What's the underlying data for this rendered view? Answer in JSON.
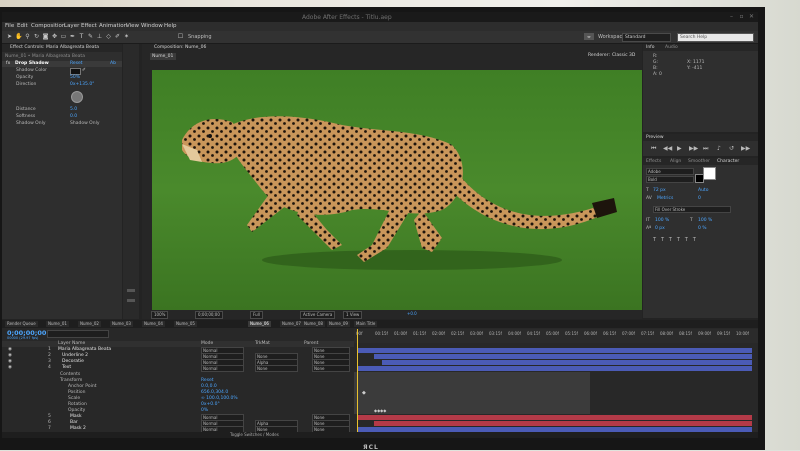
{
  "window": {
    "title": "Adobe After Effects - Titlu.aep"
  },
  "menu": [
    "File",
    "Edit",
    "Composition",
    "Layer",
    "Effect",
    "Animation",
    "View",
    "Window",
    "Help"
  ],
  "toolbar": {
    "snapping_label": "Snapping",
    "workspace_label": "Workspace:",
    "workspace_value": "Standard",
    "search_placeholder": "Search Help"
  },
  "effect_controls": {
    "tab": "Effect Controls: Maria Albagreata Beata",
    "layer": "Nume_01 • Maria Albagreata Beata",
    "effect_name": "Drop Shadow",
    "reset_label": "Reset",
    "about_label": "Ab",
    "properties": [
      {
        "name": "Shadow Color",
        "value": ""
      },
      {
        "name": "Opacity",
        "value": "50%"
      },
      {
        "name": "Direction",
        "value": "0x+135.0°"
      },
      {
        "name": "Distance",
        "value": "5.0"
      },
      {
        "name": "Softness",
        "value": "0.0"
      },
      {
        "name": "Shadow Only",
        "value": "Shadow Only"
      }
    ],
    "accent_color": "#4ca6ff"
  },
  "composition": {
    "tab": "Composition: Nume_06",
    "sub_tab": "Nume_01",
    "renderer_label": "Renderer:",
    "renderer_value": "Classic 3D",
    "viewer_controls": [
      "100%",
      "0;00;00;00",
      "Full",
      "Active Camera",
      "1 View",
      "+0.0"
    ]
  },
  "info_panel": {
    "tabs": [
      "Info",
      "Audio"
    ],
    "lines": [
      "R:",
      "G:",
      "B:",
      "A: 0",
      "X: 1171",
      "Y: -411"
    ]
  },
  "preview_panel": {
    "tab": "Preview"
  },
  "character_panel": {
    "tabs": [
      "Effects",
      "Align",
      "Smoother",
      "Character"
    ],
    "font": "Adobe",
    "style": "Bold",
    "size": "72 px",
    "leading": "Auto",
    "kerning": "Metrics",
    "tracking": "0",
    "stroke": "Fill Over Stroke",
    "scale_v": "100 %",
    "scale_h": "100 %",
    "baseline": "0 px",
    "tsume": "0 %"
  },
  "timeline": {
    "tabs": [
      "Render Queue",
      "Nume_01",
      "Nume_02",
      "Nume_03",
      "Nume_04",
      "Nume_05",
      "Nume_06",
      "Nume_07",
      "Nume_08",
      "Nume_09",
      "Main Title"
    ],
    "timecode": "0;00;00;00",
    "frame_info": "00000 (29.97 fps)",
    "columns": {
      "layer_name": "Layer Name",
      "mode": "Mode",
      "trkmat": "TrkMat",
      "parent": "Parent"
    },
    "layers": [
      {
        "num": "1",
        "name": "Maria Albagreata Beata",
        "mode": "Normal",
        "trkmat": "",
        "parent": "None"
      },
      {
        "num": "2",
        "name": "Underline 2",
        "mode": "Normal",
        "trkmat": "None",
        "parent": "None"
      },
      {
        "num": "3",
        "name": "Decoratie",
        "mode": "Normal",
        "trkmat": "Alpha",
        "parent": "None"
      },
      {
        "num": "4",
        "name": "Text",
        "mode": "Normal",
        "trkmat": "None",
        "parent": "None"
      }
    ],
    "sublayers": [
      {
        "name": "Contents",
        "value": ""
      },
      {
        "name": "Transform",
        "value": "Reset"
      },
      {
        "name": "Anchor Point",
        "value": "0.0,0.0"
      },
      {
        "name": "Position",
        "value": "656.0,304.0"
      },
      {
        "name": "Scale",
        "value": "∞ 100.0,100.0%"
      },
      {
        "name": "Rotation",
        "value": "0x+0.0°"
      },
      {
        "name": "Opacity",
        "value": "0%"
      }
    ],
    "layers_bottom": [
      {
        "num": "5",
        "name": "Mask",
        "mode": "Normal",
        "trkmat": "",
        "parent": "None"
      },
      {
        "num": "6",
        "name": "Bar",
        "mode": "Normal",
        "trkmat": "Alpha",
        "parent": "None"
      },
      {
        "num": "7",
        "name": "Mask 2",
        "mode": "Normal",
        "trkmat": "None",
        "parent": "None"
      },
      {
        "num": "8",
        "name": "Underline",
        "mode": "Normal",
        "trkmat": "Alpha",
        "parent": "None"
      }
    ],
    "ruler": [
      "00f",
      "00:15f",
      "01:00f",
      "01:15f",
      "02:00f",
      "02:15f",
      "03:00f",
      "03:15f",
      "04:00f",
      "04:15f",
      "05:00f",
      "05:15f",
      "06:00f",
      "06:15f",
      "07:00f",
      "07:15f",
      "08:00f",
      "08:15f",
      "09:00f",
      "09:15f",
      "10:00f"
    ],
    "footer": "Toggle Switches / Modes",
    "colors": {
      "blue_bar": "#4b5bb6",
      "red_bar": "#b43a48",
      "cti": "#e8c12d"
    }
  },
  "monitor": {
    "brand": "ЯСL"
  }
}
